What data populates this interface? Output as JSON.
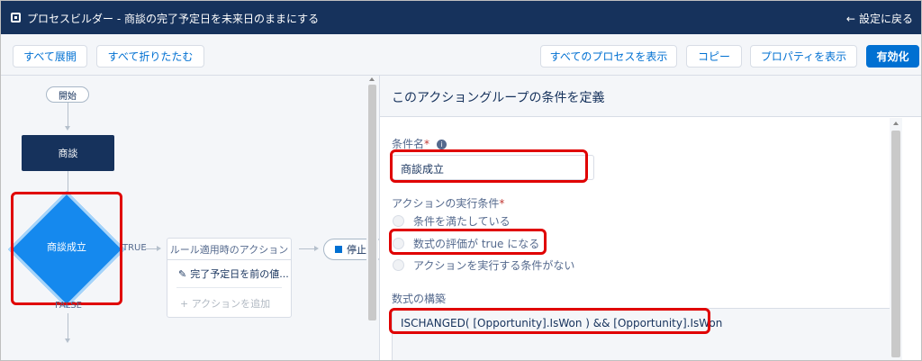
{
  "header": {
    "title": "プロセスビルダー - 商談の完了予定日を未来日のままにする",
    "back_label": "設定に戻る"
  },
  "toolbar": {
    "expand_all": "すべて展開",
    "collapse_all": "すべて折りたたむ",
    "view_all_processes": "すべてのプロセスを表示",
    "copy": "コピー",
    "view_properties": "プロパティを表示",
    "activate": "有効化"
  },
  "canvas": {
    "start_label": "開始",
    "object_label": "商談",
    "criteria_label": "商談成立",
    "true_label": "TRUE",
    "false_label": "FALSE",
    "action_group": {
      "title": "ルール適用時のアクション",
      "action_label": "完了予定日を前の値...",
      "add_action": "+ アクションを追加"
    },
    "stop_label": "停止"
  },
  "panel": {
    "header": "このアクショングループの条件を定義",
    "criteria_name_label": "条件名",
    "criteria_name_value": "商談成立",
    "execute_label": "アクションの実行条件",
    "options": [
      "条件を満たしている",
      "数式の評価が true になる",
      "アクションを実行する条件がない"
    ],
    "selected_option": 1,
    "formula_label": "数式の構築",
    "formula_value": "ISCHANGED( [Opportunity].IsWon ) && [Opportunity].IsWon"
  },
  "colors": {
    "brand_dark": "#16325c",
    "brand_blue": "#0070d2",
    "criteria_blue": "#1589ee",
    "highlight_red": "#e00000"
  },
  "icons": [
    "process-builder-icon",
    "back-arrow-icon",
    "pencil-icon",
    "info-icon",
    "stop-square-icon"
  ]
}
